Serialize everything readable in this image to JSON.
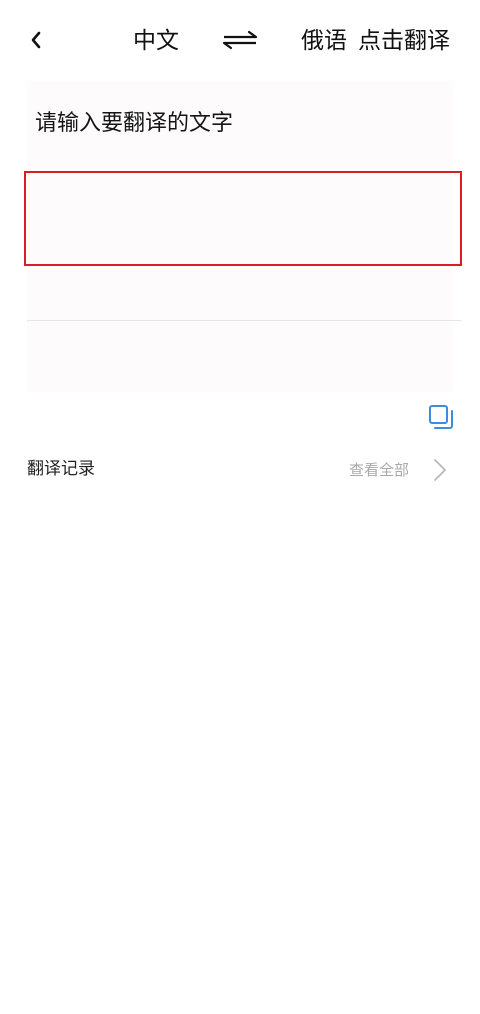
{
  "header": {
    "back_icon": "chevron-left-icon",
    "source_language": "中文",
    "swap_icon": "swap-arrows-icon",
    "target_language": "俄语",
    "translate_label": "点击翻译"
  },
  "input": {
    "prompt": "请输入要翻译的文字",
    "value": ""
  },
  "actions": {
    "copy_icon": "copy-icon"
  },
  "history": {
    "title": "翻译记录",
    "view_all_label": "查看全部",
    "view_all_icon": "chevron-right-icon"
  },
  "colors": {
    "highlight_border": "#d42020",
    "panel_background": "#fdfbfc",
    "accent_blue": "#3b8de0",
    "muted_text": "#a9a9a9"
  }
}
